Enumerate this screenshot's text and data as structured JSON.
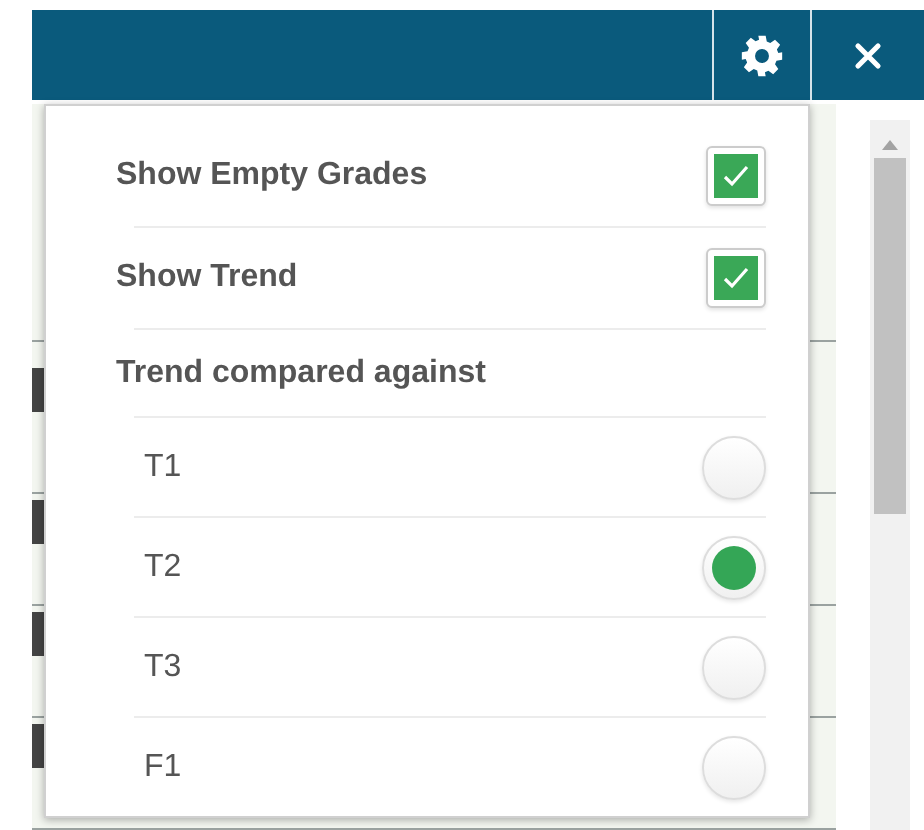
{
  "settings": {
    "options": [
      {
        "label": "Show Empty Grades",
        "checked": true
      },
      {
        "label": "Show Trend",
        "checked": true
      }
    ],
    "compare": {
      "heading": "Trend compared against",
      "choices": [
        {
          "label": "T1",
          "selected": false
        },
        {
          "label": "T2",
          "selected": true
        },
        {
          "label": "T3",
          "selected": false
        },
        {
          "label": "F1",
          "selected": false
        }
      ]
    }
  }
}
